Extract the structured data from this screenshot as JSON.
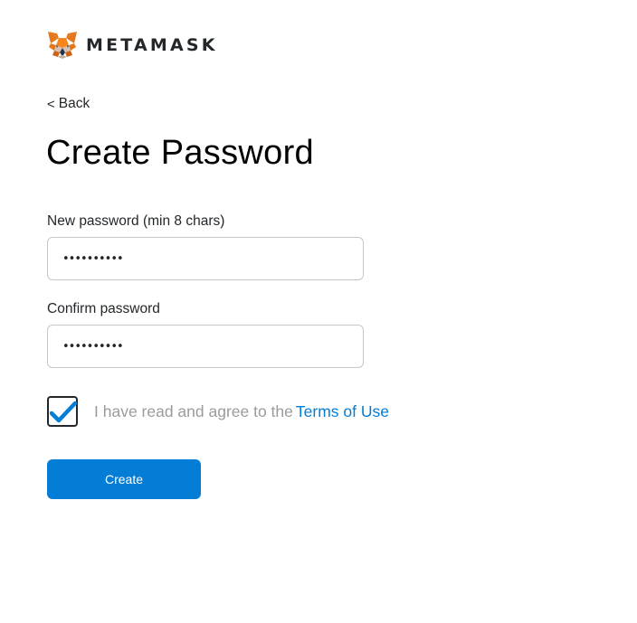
{
  "header": {
    "logo_icon": "metamask-fox-icon",
    "brand_text": "METAMASK"
  },
  "back": {
    "icon": "chevron-left-icon",
    "chevron": "<",
    "label": "Back"
  },
  "page_title": "Create Password",
  "new_password": {
    "label": "New password (min 8 chars)",
    "value": "••••••••••"
  },
  "confirm_password": {
    "label": "Confirm password",
    "value": "••••••••••"
  },
  "terms": {
    "checked": true,
    "check_icon": "checkmark-icon",
    "agree_text": "I have read and agree to the",
    "link_text": "Terms of Use"
  },
  "create_button": {
    "label": "Create"
  },
  "colors": {
    "accent": "#037dd6",
    "text": "#24272a",
    "muted": "#9b9b9b",
    "border": "#c7c7c7"
  }
}
